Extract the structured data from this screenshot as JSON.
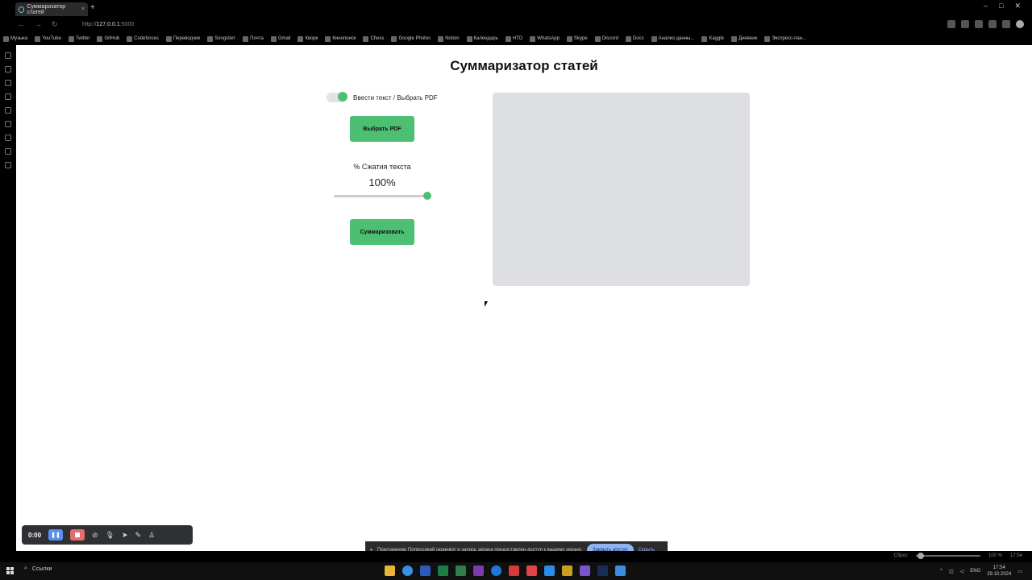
{
  "browser": {
    "tab_title": "Суммаризатор статей",
    "url_prefix": "http://",
    "url_host": "127.0.0.1",
    "url_port": ":5000",
    "bookmarks": [
      "Музыка",
      "YouTube",
      "Twitter",
      "GitHub",
      "Codeforces",
      "Переводчик",
      "Songsterr",
      "Почта",
      "Gmail",
      "Кворк",
      "Кинопоиск",
      "Chess",
      "Google Photos",
      "Notion",
      "Календарь",
      "НТО",
      "WhatsApp",
      "Skype",
      "Discord",
      "Docs",
      "Анализ данны...",
      "Kaggle",
      "Дневник",
      "Экспресс-пан..."
    ]
  },
  "app": {
    "title": "Суммаризатор статей",
    "toggle_label": "Ввести текст / Выбрать PDF",
    "toggle_on": true,
    "pick_pdf_label": "Выбрать PDF",
    "compress_label": "% Сжатия текста",
    "compress_value": "100%",
    "compress_fraction": 1.0,
    "summarize_label": "Суммаризовать"
  },
  "recorder": {
    "time": "0:00"
  },
  "sharebar": {
    "text": "Приложению Попросякий скринвот и запись экрана предоставлен доступ к вашему экрану.",
    "close_access": "Закрыть доступ",
    "hide": "Скрыть"
  },
  "status": {
    "reset": "Сброс",
    "zoom": "100 %",
    "time": "17:54"
  },
  "taskbar": {
    "search_label": "Ссылки",
    "lang": "ENG",
    "clock_time": "17:54",
    "clock_date": "29.10.2024"
  },
  "colors": {
    "accent": "#4dbf73",
    "output_bg": "#dedfe3"
  }
}
